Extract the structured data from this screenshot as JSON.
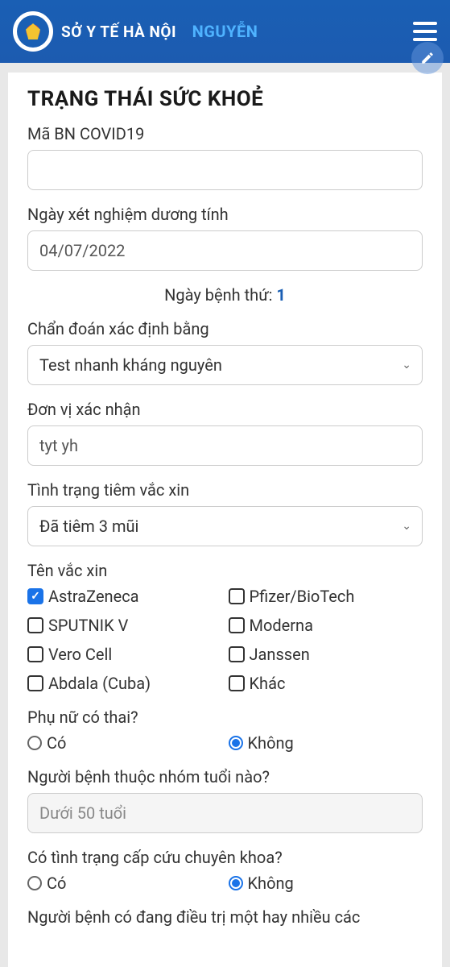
{
  "header": {
    "title": "SỞ Y TẾ HÀ NỘI",
    "user": "NGUYỄN"
  },
  "page_title": "TRẠNG THÁI SỨC KHOẺ",
  "fields": {
    "covid_code": {
      "label": "Mã BN COVID19",
      "value": ""
    },
    "positive_date": {
      "label": "Ngày xét nghiệm dương tính",
      "value": "04/07/2022"
    },
    "day_count": {
      "label": "Ngày bệnh thứ:",
      "value": "1"
    },
    "diagnosis_method": {
      "label": "Chẩn đoán xác định bằng",
      "value": "Test nhanh kháng nguyên"
    },
    "confirm_unit": {
      "label": "Đơn vị xác nhận",
      "value": "tyt yh"
    },
    "vaccine_status": {
      "label": "Tình trạng tiêm vắc xin",
      "value": "Đã tiêm 3 mũi"
    },
    "vaccines": {
      "label": "Tên vắc xin",
      "options": [
        {
          "label": "AstraZeneca",
          "checked": true
        },
        {
          "label": "Pfizer/BioTech",
          "checked": false
        },
        {
          "label": "SPUTNIK V",
          "checked": false
        },
        {
          "label": "Moderna",
          "checked": false
        },
        {
          "label": "Vero Cell",
          "checked": false
        },
        {
          "label": "Janssen",
          "checked": false
        },
        {
          "label": "Abdala (Cuba)",
          "checked": false
        },
        {
          "label": "Khác",
          "checked": false
        }
      ]
    },
    "pregnant": {
      "label": "Phụ nữ có thai?",
      "options": [
        {
          "label": "Có",
          "selected": false
        },
        {
          "label": "Không",
          "selected": true
        }
      ]
    },
    "age_group": {
      "label": "Người bệnh thuộc nhóm tuổi nào?",
      "value": "Dưới 50 tuổi"
    },
    "emergency": {
      "label": "Có tình trạng cấp cứu chuyên khoa?",
      "options": [
        {
          "label": "Có",
          "selected": false
        },
        {
          "label": "Không",
          "selected": true
        }
      ]
    },
    "treatment_question": {
      "label": "Người bệnh có đang điều trị một hay nhiều các"
    }
  }
}
